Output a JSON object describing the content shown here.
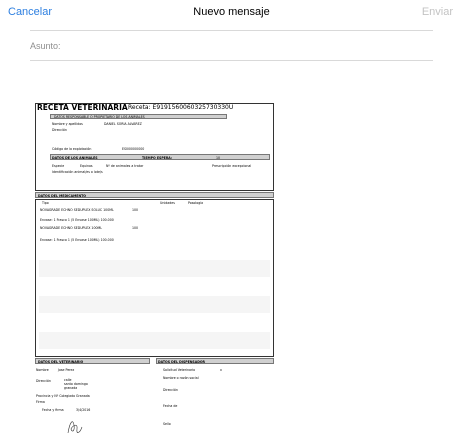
{
  "nav": {
    "cancel": "Cancelar",
    "title": "Nuevo mensaje",
    "send": "Enviar"
  },
  "subject": {
    "label": "Asunto:"
  },
  "doc": {
    "title": "RECETA VETERINARIA",
    "receta": "Receta: E9191560060325730330U",
    "owner_header": "DATOS RESPONSABLE O PROPIETARIO DE LOS ANIMALES",
    "owner_name_label": "Nombre y apellidos",
    "owner_name_value": "DANIEL SORIA ALVAREZ",
    "owner_address_label": "Dirección",
    "exploit_label": "Código de la explotación",
    "exploit_value": "ES000000000",
    "animals_header": "DATOS DE LOS ANIMALES",
    "wait_header": "TIEMPO ESPERA:",
    "wait_value": "10",
    "species_label": "Especie",
    "species_value": "Equinos",
    "animals_label": "Nº de animales a tratar",
    "id_label": "Identificación animal/es o lote/s",
    "presc_label": "Prescripción excepcional",
    "med_header": "DATOS DEL MEDICAMENTO",
    "col_name": "Tipo",
    "col_qty": "Unidades",
    "col_posology": "Posología",
    "med1": "NOVAGRADE ECHNO SEDUPLEX SOLUC 100ML",
    "med1_qty": "100",
    "med1_b": "Envase: 1 Frasco 1 (5 Envase 100ML) 100.000",
    "med2": "NOVAGRADE ECHNO SEDUPLEX 100ML",
    "med2_qty": "100",
    "med2_b": "Envase: 1 Frasco 1 (5 Envase 100ML) 100.000",
    "vet_header": "DATOS DEL VETERINARIO",
    "disp_header": "DATOS DEL DISPENSADOR",
    "vet_name_label": "Nombre",
    "vet_name_value": "Jose Perez",
    "vet_address_label": "Dirección",
    "vet_address_value": "calle\nsanto domingo\ngranada",
    "vet_college_label": "Provincia y Nº Colegiado",
    "vet_college_value": "Granada",
    "vet_sign_label": "Firma",
    "vet_date_label": "Fecha y firma",
    "vet_date_value": "3/4/2016",
    "disp_same_label": "Solicitud Veterinario",
    "disp_same_value": "x",
    "disp_name_label": "Nombre o razón social",
    "disp_address_label": "Dirección",
    "disp_date_label": "Fecha de",
    "disp_stamp_label": "Sello"
  }
}
